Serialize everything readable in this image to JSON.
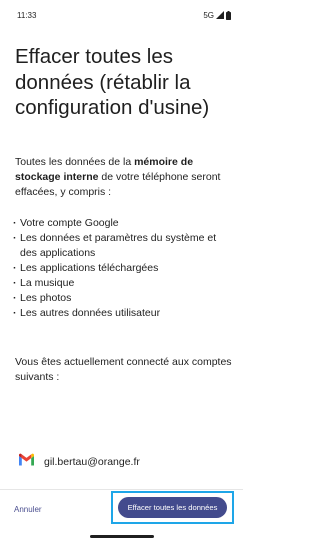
{
  "status_bar": {
    "time": "11:33",
    "network": "5G"
  },
  "title": "Effacer toutes les données (rétablir la configuration d'usine)",
  "intro": {
    "before": "Toutes les données de la ",
    "bold": "mémoire de stockage interne",
    "after": " de votre téléphone seront effacées, y compris :"
  },
  "erased_items": [
    "Votre compte Google",
    "Les données et paramètres du système et des applications",
    "Les applications téléchargées",
    "La musique",
    "Les photos",
    "Les autres données utilisateur"
  ],
  "accounts_intro": "Vous êtes actuellement connecté aux comptes suivants :",
  "account": {
    "email": "gil.bertau@orange.fr",
    "icon": "gmail-icon"
  },
  "actions": {
    "cancel_label": "Annuler",
    "confirm_label": "Effacer toutes les données"
  },
  "colors": {
    "primary_button": "#434b8d",
    "cancel_text": "#4a4e8f",
    "highlight_outline": "#1ea6e8"
  }
}
